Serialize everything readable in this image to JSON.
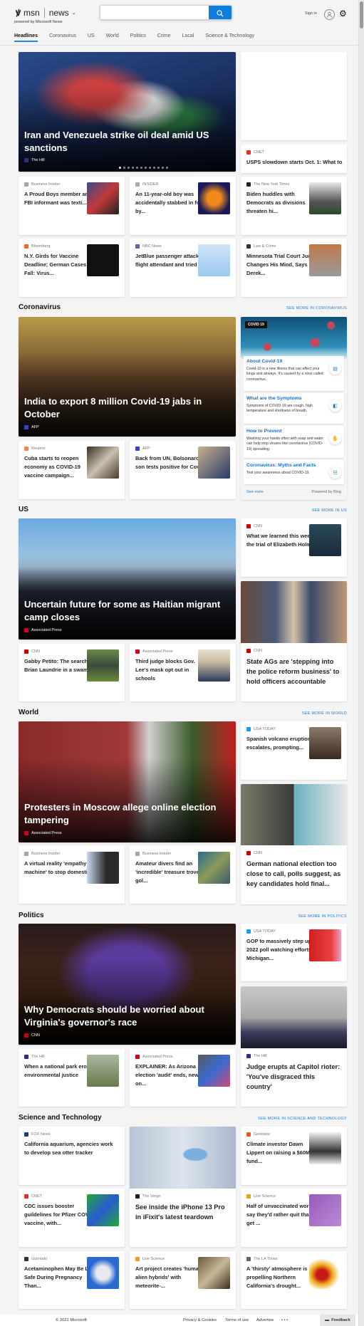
{
  "header": {
    "logo": "msn",
    "brand": "news",
    "tagline": "powered by Microsoft News",
    "search_value": "",
    "sign_in": "Sign in"
  },
  "nav": [
    {
      "label": "Headlines",
      "active": true
    },
    {
      "label": "Coronavirus"
    },
    {
      "label": "US"
    },
    {
      "label": "World"
    },
    {
      "label": "Politics"
    },
    {
      "label": "Crime"
    },
    {
      "label": "Local"
    },
    {
      "label": "Science & Technology"
    }
  ],
  "headlines": {
    "hero": {
      "title": "Iran and Venezuela strike oil deal amid US sanctions",
      "source": "The Hill",
      "carousel": {
        "count": 12,
        "active": 1
      }
    },
    "side": {
      "source": "CNET",
      "title": "USPS slowdown starts Oct. 1: What to..."
    },
    "cards": [
      {
        "source": "Business Insider",
        "title": "A Proud Boys member and FBI informant was texti..."
      },
      {
        "source": "INSIDER",
        "title": "An 11-year-old boy was accidentally stabbed in foot by..."
      },
      {
        "source": "The New York Times",
        "title": "Biden huddles with Democrats as divisions threaten hi..."
      },
      {
        "source": "Bloomberg",
        "title": "N.Y. Girds for Vaccine Deadline; German Cases Fall: Virus..."
      },
      {
        "source": "NBC News",
        "title": "JetBlue passenger attacked flight attendant and tried ..."
      },
      {
        "source": "Law & Crime",
        "title": "Minnesota Trial Court Judge Changes His Mind, Says Derek..."
      }
    ]
  },
  "coronavirus": {
    "title": "Coronavirus",
    "see_more": "SEE MORE IN CORONAVIRUS",
    "hero": {
      "title": "India to export 8 million Covid-19 jabs in October",
      "source": "AFP"
    },
    "covid": {
      "badge": "COVID 19",
      "items": [
        {
          "title": "About Covid-19",
          "desc": "Covid-19 is a new illness that can affect your lungs and airways. It's caused by a virus called coronavirus."
        },
        {
          "title": "What are the Symptoms",
          "desc": "Symptoms of COVID-19 are cough, high temperature and shortness of breath."
        },
        {
          "title": "How to Prevent",
          "desc": "Washing your hands often with soap and water can help stop viruses like coronavirus (COVID-19) spreading."
        },
        {
          "title": "Coronavirus: Myths and Facts",
          "desc": "Test your awareness about COVID-19."
        }
      ],
      "see_more": "See more",
      "powered": "Powered by Bing"
    },
    "cards": [
      {
        "source": "Reuters",
        "title": "Cuba starts to reopen economy as COVID-19 vaccine campaign..."
      },
      {
        "source": "AFP",
        "title": "Back from UN, Bolsonaro son tests positive for Covid"
      }
    ]
  },
  "us": {
    "title": "US",
    "see_more": "SEE MORE IN US",
    "hero": {
      "title": "Uncertain future for some as Haitian migrant camp closes",
      "source": "Associated Press"
    },
    "side": {
      "source": "CNN",
      "title": "What we learned this week in the trial of Elizabeth Holmes"
    },
    "feature": {
      "source": "CNN",
      "title": "State AGs are 'stepping into the police reform business' to hold officers accountable"
    },
    "cards": [
      {
        "source": "CNN",
        "title": "Gabby Petito: The search for Brian Laundrie in a swam..."
      },
      {
        "source": "Associated Press",
        "title": "Third judge blocks Gov. Lee's mask opt out in schools"
      }
    ]
  },
  "world": {
    "title": "World",
    "see_more": "SEE MORE IN WORLD",
    "hero": {
      "title": "Protesters in Moscow allege online election tampering",
      "source": "Associated Press"
    },
    "side": {
      "source": "USA TODAY",
      "title": "Spanish volcano eruption escalates, prompting..."
    },
    "feature": {
      "source": "CNN",
      "title": "German national election too close to call, polls suggest, as key candidates hold final..."
    },
    "cards": [
      {
        "source": "Business Insider",
        "title": "A virtual reality 'empathy machine' to stop domestic..."
      },
      {
        "source": "Business Insider",
        "title": "Amateur divers find an 'incredible' treasure trove of gol..."
      }
    ]
  },
  "politics": {
    "title": "Politics",
    "see_more": "SEE MORE IN POLITICS",
    "hero": {
      "title": "Why Democrats should be worried about Virginia's governor's race",
      "source": "CNN"
    },
    "side": {
      "source": "USA TODAY",
      "title": "GOP to massively step up 2022 poll watching efforts in Michigan..."
    },
    "feature": {
      "source": "The Hill",
      "title": "Judge erupts at Capitol rioter: 'You've disgraced this country'"
    },
    "cards": [
      {
        "source": "The Hill",
        "title": "When a national park erodes environmental justice"
      },
      {
        "source": "Associated Press",
        "title": "EXPLAINER: As Arizona election 'audit' ends, new on..."
      }
    ]
  },
  "science": {
    "title": "Science and Technology",
    "see_more": "SEE MORE IN SCIENCE AND TECHNOLOGY",
    "fox": {
      "source": "FOX News",
      "title": "California aquarium, agencies work to develop sea otter tracker"
    },
    "feature": {
      "source": "The Verge",
      "title": "See inside the iPhone 13 Pro in iFixit's latest teardown"
    },
    "cards": [
      {
        "source": "Geekwire",
        "title": "Climate investor Dawn Lippert on raising a $60M fund..."
      },
      {
        "source": "CNET",
        "title": "CDC issues booster guildelines for Pfizer COVID vaccine, with..."
      },
      {
        "source": "Live Science",
        "title": "Half of unvaccinated workers say they'd rather quit than get ..."
      },
      {
        "source": "Gizmodo",
        "title": "Acetaminophen May Be Less Safe During Pregnancy Than..."
      },
      {
        "source": "Live Science",
        "title": "Art project creates 'human-alien hybrids' with meteorite-..."
      },
      {
        "source": "The LA Times",
        "title": "A 'thirsty' atmosphere is propelling Northern California's drought..."
      }
    ]
  },
  "footer": {
    "copyright": "© 2021 Microsoft",
    "links": [
      "Privacy & Cookies",
      "Terms of use",
      "Advertise"
    ],
    "more": "• • •",
    "feedback": "Feedback"
  },
  "colors": {
    "accent": "#0f7ddd",
    "link": "#1e7bd6",
    "cnn": "#cc0000"
  }
}
